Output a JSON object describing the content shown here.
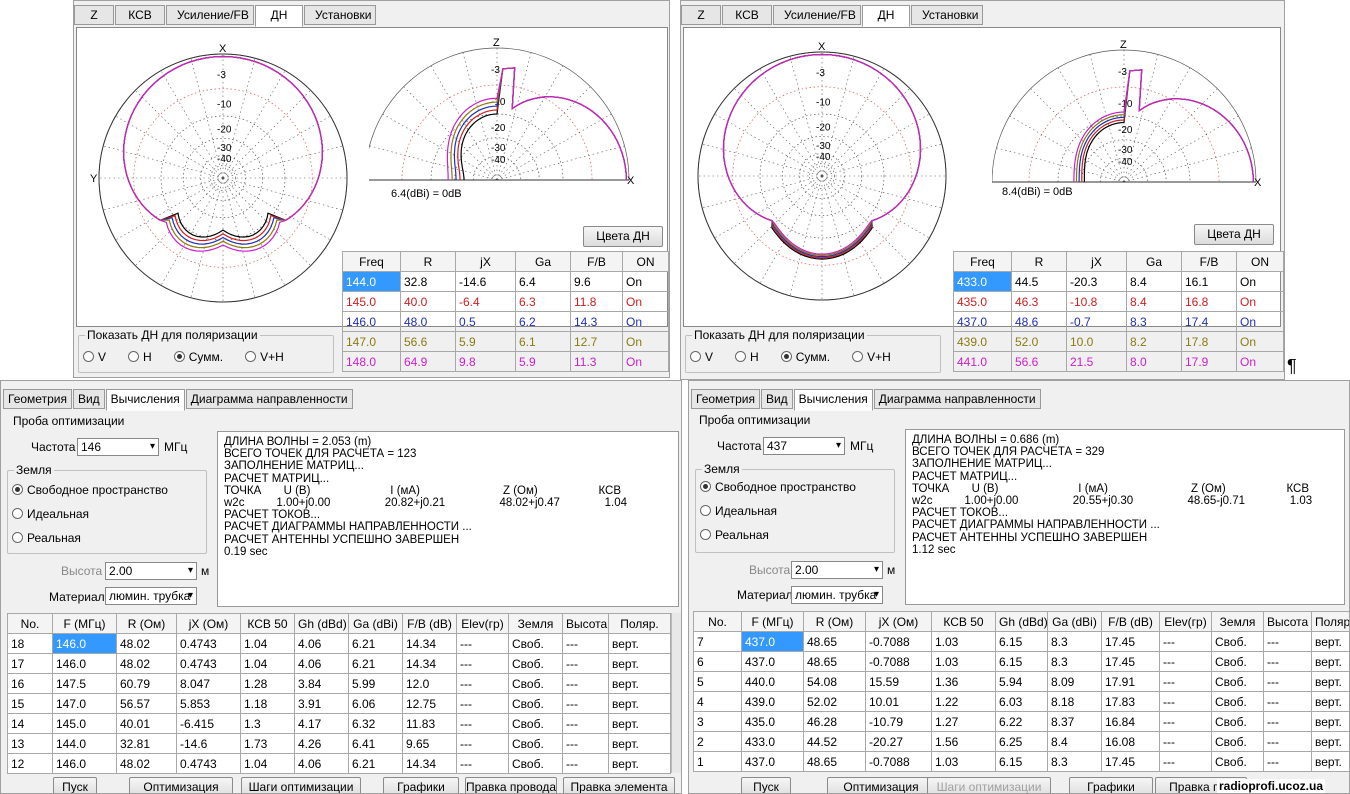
{
  "dn_tabs": [
    "Z",
    "КСВ",
    "Усиление/FB",
    "ДН",
    "Установки"
  ],
  "left_dn": {
    "scale_labels": [
      "-3",
      "-10",
      "-20",
      "-30",
      "-40"
    ],
    "ax_x": "X",
    "ax_y": "Y",
    "ax_z": "Z",
    "gain_label": "6.4(dBi) = 0dB",
    "colors_button": "Цвета ДН",
    "headers": [
      "Freq",
      "R",
      "jX",
      "Ga",
      "F/B",
      "ON"
    ],
    "rows": [
      [
        "144.0",
        "32.8",
        "-14.6",
        "6.4",
        "9.6",
        "On"
      ],
      [
        "145.0",
        "40.0",
        "-6.4",
        "6.3",
        "11.8",
        "On"
      ],
      [
        "146.0",
        "48.0",
        "0.5",
        "6.2",
        "14.3",
        "On"
      ],
      [
        "147.0",
        "56.6",
        "5.9",
        "6.1",
        "12.7",
        "On"
      ],
      [
        "148.0",
        "64.9",
        "9.8",
        "5.9",
        "11.3",
        "On"
      ]
    ]
  },
  "right_dn": {
    "gain_label": "8.4(dBi) = 0dB",
    "colors_button": "Цвета ДН",
    "rows": [
      [
        "433.0",
        "44.5",
        "-20.3",
        "8.4",
        "16.1",
        "On"
      ],
      [
        "435.0",
        "46.3",
        "-10.8",
        "8.4",
        "16.8",
        "On"
      ],
      [
        "437.0",
        "48.6",
        "-0.7",
        "8.3",
        "17.4",
        "On"
      ],
      [
        "439.0",
        "52.0",
        "10.0",
        "8.2",
        "17.8",
        "On"
      ],
      [
        "441.0",
        "56.6",
        "21.5",
        "8.0",
        "17.9",
        "On"
      ]
    ]
  },
  "row_colors": [
    "#000000",
    "#cc2020",
    "#2030b0",
    "#8a7a10",
    "#cc20cc"
  ],
  "polarization": {
    "title": "Показать ДН для поляризации",
    "options": [
      "V",
      "H",
      "Сумм.",
      "V+H"
    ],
    "selected": "Сумм."
  },
  "pilcrow": "¶",
  "calc_tabs": [
    "Геометрия",
    "Вид",
    "Вычисления",
    "Диаграмма направленности"
  ],
  "calc_common": {
    "probe": "Проба оптимизации",
    "freq_label": "Частота",
    "freq_unit": "МГц",
    "ground_title": "Земля",
    "ground_options": [
      "Свободное пространство",
      "Идеальная",
      "Реальная"
    ],
    "height_label": "Высота",
    "height_value": "2.00",
    "height_unit": "м",
    "material_label": "Материал",
    "material_value": "люмин. трубка",
    "table_headers": [
      "No.",
      "F (МГц)",
      "R (Ом)",
      "jX (Ом)",
      "КСВ 50",
      "Gh (dBd)",
      "Ga (dBi)",
      "F/B (dB)",
      "Elev(гр)",
      "Земля",
      "Высота",
      "Поляр."
    ],
    "buttons": [
      "Пуск",
      "Оптимизация",
      "Шаги оптимизации",
      "Графики",
      "Правка провода",
      "Правка элемента"
    ]
  },
  "calc_left": {
    "freq": "146",
    "log": "ДЛИНА ВОЛНЫ = 2.053 (m)\nВСЕГО ТОЧЕК ДЛЯ РАСЧЕТА = 123\nЗАПОЛНЕНИЕ МАТРИЦ...\nРАСЧЕТ МАТРИЦ...\nТОЧКА       U (B)                         I (мА)                          Z (Ом)                   КСВ\nw2c          1.00+j0.00                 20.82+j0.21                 48.02+j0.47              1.04\nРАСЧЕТ ТОКОВ...\nРАСЧЕТ ДИАГРАММЫ НАПРАВЛЕННОСТИ ...\nРАСЧЕТ АНТЕННЫ УСПЕШНО ЗАВЕРШЕН\n0.19 sec",
    "rows": [
      [
        "18",
        "146.0",
        "48.02",
        "0.4743",
        "1.04",
        "4.06",
        "6.21",
        "14.34",
        "---",
        "Своб.",
        "---",
        "верт."
      ],
      [
        "17",
        "146.0",
        "48.02",
        "0.4743",
        "1.04",
        "4.06",
        "6.21",
        "14.34",
        "---",
        "Своб.",
        "---",
        "верт."
      ],
      [
        "16",
        "147.5",
        "60.79",
        "8.047",
        "1.28",
        "3.84",
        "5.99",
        "12.0",
        "---",
        "Своб.",
        "---",
        "верт."
      ],
      [
        "15",
        "147.0",
        "56.57",
        "5.853",
        "1.18",
        "3.91",
        "6.06",
        "12.75",
        "---",
        "Своб.",
        "---",
        "верт."
      ],
      [
        "14",
        "145.0",
        "40.01",
        "-6.415",
        "1.3",
        "4.17",
        "6.32",
        "11.83",
        "---",
        "Своб.",
        "---",
        "верт."
      ],
      [
        "13",
        "144.0",
        "32.81",
        "-14.6",
        "1.73",
        "4.26",
        "6.41",
        "9.65",
        "---",
        "Своб.",
        "---",
        "верт."
      ],
      [
        "12",
        "146.0",
        "48.02",
        "0.4743",
        "1.04",
        "4.06",
        "6.21",
        "14.34",
        "---",
        "Своб.",
        "---",
        "верт."
      ]
    ]
  },
  "calc_right": {
    "freq": "437",
    "log": "ДЛИНА ВОЛНЫ = 0.686 (m)\nВСЕГО ТОЧЕК ДЛЯ РАСЧЕТА = 329\nЗАПОЛНЕНИЕ МАТРИЦ...\nРАСЧЕТ МАТРИЦ...\nТОЧКА       U (B)                         I (мА)                          Z (Ом)                   КСВ\nw2c          1.00+j0.00                 20.55+j0.30                 48.65-j0.71              1.03\nРАСЧЕТ ТОКОВ...\nРАСЧЕТ ДИАГРАММЫ НАПРАВЛЕННОСТИ ...\nРАСЧЕТ АНТЕННЫ УСПЕШНО ЗАВЕРШЕН\n1.12 sec",
    "rows": [
      [
        "7",
        "437.0",
        "48.65",
        "-0.7088",
        "1.03",
        "6.15",
        "8.3",
        "17.45",
        "---",
        "Своб.",
        "---",
        "верт."
      ],
      [
        "6",
        "437.0",
        "48.65",
        "-0.7088",
        "1.03",
        "6.15",
        "8.3",
        "17.45",
        "---",
        "Своб.",
        "---",
        "верт."
      ],
      [
        "5",
        "440.0",
        "54.08",
        "15.59",
        "1.36",
        "5.94",
        "8.09",
        "17.91",
        "---",
        "Своб.",
        "---",
        "верт."
      ],
      [
        "4",
        "439.0",
        "52.02",
        "10.01",
        "1.22",
        "6.03",
        "8.18",
        "17.83",
        "---",
        "Своб.",
        "---",
        "верт."
      ],
      [
        "3",
        "435.0",
        "46.28",
        "-10.79",
        "1.27",
        "6.22",
        "8.37",
        "16.84",
        "---",
        "Своб.",
        "---",
        "верт."
      ],
      [
        "2",
        "433.0",
        "44.52",
        "-20.27",
        "1.56",
        "6.25",
        "8.4",
        "16.08",
        "---",
        "Своб.",
        "---",
        "верт."
      ],
      [
        "1",
        "437.0",
        "48.65",
        "-0.7088",
        "1.03",
        "6.15",
        "8.3",
        "17.45",
        "---",
        "Своб.",
        "---",
        "верт."
      ]
    ],
    "button_edit_wire": "Правка про"
  },
  "watermark": "radioprofi.ucoz.ua"
}
